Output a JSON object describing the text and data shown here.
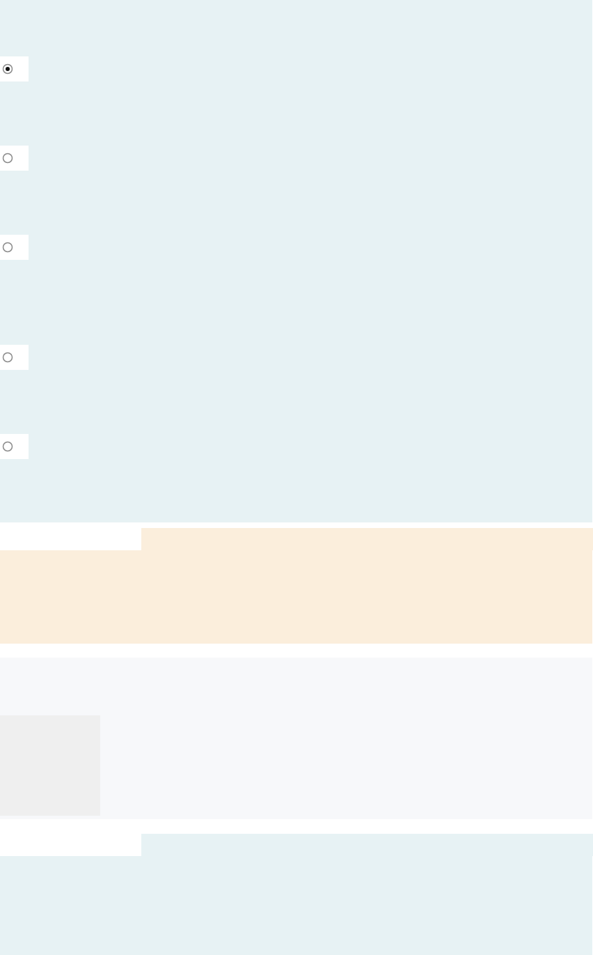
{
  "options": [
    {
      "selected": true
    },
    {
      "selected": false
    },
    {
      "selected": false
    },
    {
      "selected": false
    },
    {
      "selected": false
    }
  ]
}
